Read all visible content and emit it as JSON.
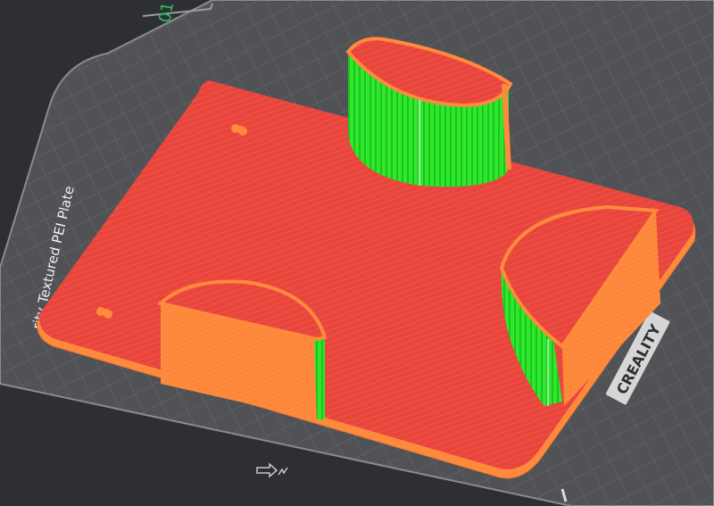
{
  "viewport": {
    "plate_number": "01",
    "plate_name": "rity Textured PEI Plate",
    "brand_logo": "CREALITY",
    "colors": {
      "background": "#2e2f33",
      "bed": "#505256",
      "grid": "#6a6c70",
      "wall_outer": "#e8453c",
      "wall_inner": "#ff8a3d",
      "support": "#2ee82e",
      "plate_number": "#29c35a"
    },
    "icons": [
      "bed-arrow-icon"
    ]
  }
}
